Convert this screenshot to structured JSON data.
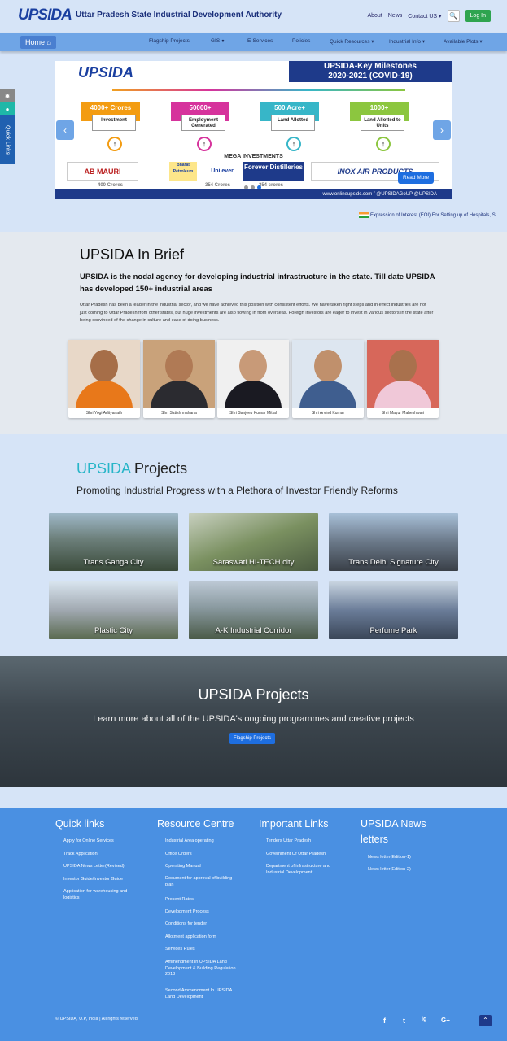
{
  "header": {
    "logo_text": "UPSIDA",
    "org_name": "Uttar Pradesh State Industrial Development Authority",
    "links": [
      "About",
      "News",
      "Contact US ▾"
    ],
    "login_label": "Log In"
  },
  "nav": {
    "home_label": "Home",
    "items": [
      "Flagship Projects",
      "GIS",
      "E-Services",
      "Policies",
      "Quick Resources ▾",
      "Industrial Info ▾",
      "Available Plots ▾"
    ]
  },
  "carousel": {
    "logo": "UPSIDA",
    "title_line1": "UPSIDA-Key Milestones",
    "title_line2": "2020-2021 (COVID-19)",
    "milestones": [
      {
        "value": "4000+ Crores",
        "label": "Investment",
        "color": "#f39c12"
      },
      {
        "value": "50000+",
        "label": "Employment Generated",
        "color": "#d6339c"
      },
      {
        "value": "500 Acre+",
        "label": "Land Allotted",
        "color": "#37b6c8"
      },
      {
        "value": "1000+",
        "label": "Land Allotted to Units",
        "color": "#8cc63f"
      }
    ],
    "mega_label": "MEGA INVESTMENTS",
    "brands": [
      "AB MAURI",
      "Bharat Petroleum",
      "Unilever",
      "Forever Distilleries",
      "INOX AIR PRODUCTS"
    ],
    "crores": [
      "400 Crores",
      "354 Crores",
      "354 crores"
    ],
    "footer_text": "www.onlineupsidc.com  f @UPSIDAGoUP  @UPSIDA",
    "read_more": "Read More"
  },
  "quick_links_tab": "Quick Links",
  "ticker": "Expression of Interest (EOI) For Setting up of Hospitals, S",
  "brief": {
    "title": "UPSIDA In Brief",
    "subtitle": "UPSIDA is the nodal agency for developing industrial infrastructure in the state. Till date UPSIDA has developed 150+ industrial areas",
    "paragraph": "Uttar Pradesh has been a leader in the industrial sector, and we have achieved this position with consistent efforts. We have taken right steps and in effect industries are not just coming to Uttar Pradesh from other states, but huge investments are also flowing in from overseas. Foreign investors are eager to invest in various sectors in the state after being convinced of the change in culture and ease of doing business.",
    "people": [
      "Shri Yogi Adityanath",
      "Shri Satish mahana",
      "Shri Sanjeev Kumar Mittal",
      "Shri Arvind Kumar",
      "Shri Mayur Maheshwari"
    ]
  },
  "projects": {
    "title_accent": "UPSIDA",
    "title_rest": "Projects",
    "subtitle": "Promoting Industrial Progress with a Plethora of Investor Friendly Reforms",
    "items": [
      "Trans Ganga City",
      "Saraswati HI-TECH city",
      "Trans Delhi Signature City",
      "Plastic City",
      "A-K Industrial Corridor",
      "Perfume Park"
    ]
  },
  "banner": {
    "title": "UPSIDA Projects",
    "subtitle": "Learn more about all of the UPSIDA's ongoing programmes and creative projects",
    "button": "Flagship Projects"
  },
  "footer": {
    "quick_links": {
      "title": "Quick links",
      "items": [
        "Apply for Online Services",
        "Track Application",
        "UPSIDA News Letter(Revised)",
        "Investor Guide/Investor Guide",
        "Application for warehousing and logistics"
      ]
    },
    "resource_centre": {
      "title": "Resource Centre",
      "items": [
        "Industrial Area operating",
        "Office Orders",
        "Operating Manual",
        "Document for approval of building plan",
        "Present Rates",
        "Development Process",
        "Conditions for tender",
        "Allotment application form",
        "Services Rules",
        "Ammendment In UPSIDA Land Development & Building Regulation 2018",
        "Second Ammendment In UPSIDA Land Development"
      ]
    },
    "important_links": {
      "title": "Important Links",
      "items": [
        "Tenders Uttar Pradesh",
        "Government Of Uttar Pradesh",
        "Department of infrastructure and Industrial Development"
      ]
    },
    "news_letters": {
      "title": "UPSIDA News letters",
      "items": [
        "News letter(Edition-1)",
        "News letter(Edition-2)"
      ]
    },
    "copyright": "© UPSIDA, U.P, India | All rights reserved.",
    "social": [
      "f",
      "t",
      "ig",
      "G+"
    ]
  }
}
